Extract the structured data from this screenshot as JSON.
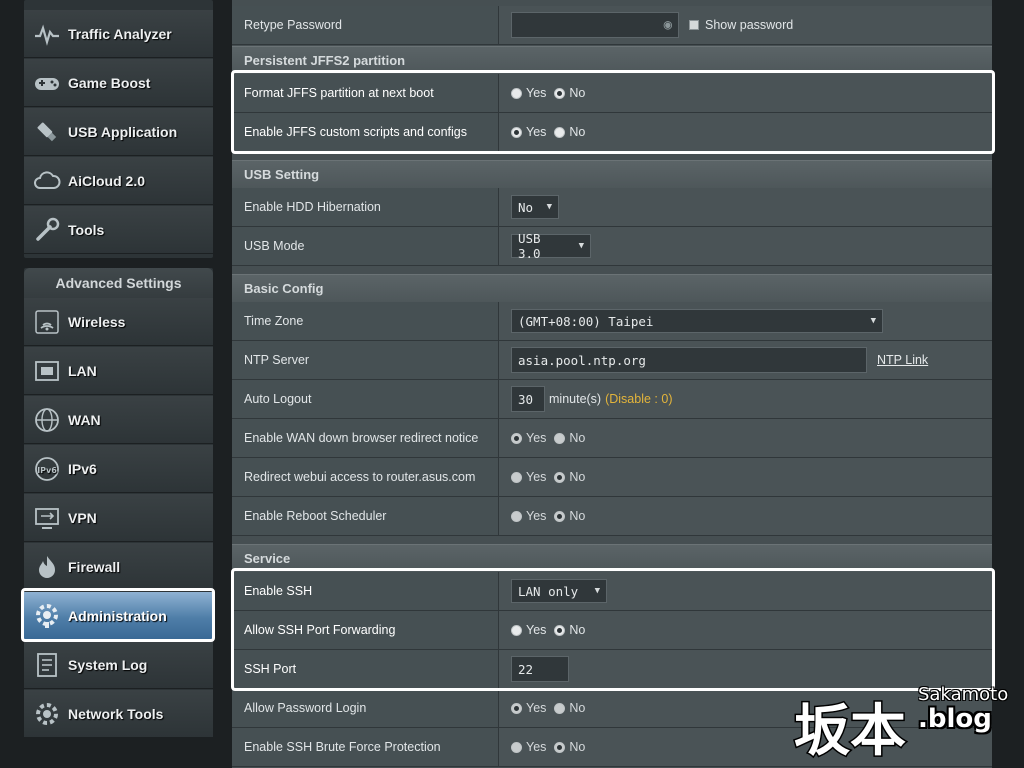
{
  "sidebar": {
    "top_items": [
      {
        "label": "Traffic Analyzer",
        "icon": "traffic-analyzer-icon"
      },
      {
        "label": "Game Boost",
        "icon": "gamepad-icon"
      },
      {
        "label": "USB Application",
        "icon": "usb-icon"
      },
      {
        "label": "AiCloud 2.0",
        "icon": "cloud-icon"
      },
      {
        "label": "Tools",
        "icon": "wrench-icon"
      }
    ],
    "advanced_heading": "Advanced Settings",
    "advanced_items": [
      {
        "label": "Wireless",
        "icon": "wireless-icon"
      },
      {
        "label": "LAN",
        "icon": "lan-icon"
      },
      {
        "label": "WAN",
        "icon": "globe-icon"
      },
      {
        "label": "IPv6",
        "icon": "ipv6-icon"
      },
      {
        "label": "VPN",
        "icon": "vpn-icon"
      },
      {
        "label": "Firewall",
        "icon": "firewall-icon"
      },
      {
        "label": "Administration",
        "icon": "admin-gear-icon",
        "active": true
      },
      {
        "label": "System Log",
        "icon": "system-log-icon"
      },
      {
        "label": "Network Tools",
        "icon": "network-tools-icon"
      }
    ]
  },
  "retype_password": {
    "label": "Retype Password",
    "value": "",
    "show_password_label": "Show password"
  },
  "jffs": {
    "header": "Persistent JFFS2 partition",
    "rows": [
      {
        "label": "Format JFFS partition at next boot",
        "yes": "Yes",
        "no": "No",
        "selected": "No"
      },
      {
        "label": "Enable JFFS custom scripts and configs",
        "yes": "Yes",
        "no": "No",
        "selected": "Yes"
      }
    ]
  },
  "usb": {
    "header": "USB Setting",
    "hdd_hibernation": {
      "label": "Enable HDD Hibernation",
      "value": "No"
    },
    "usb_mode": {
      "label": "USB Mode",
      "value": "USB 3.0"
    }
  },
  "basic": {
    "header": "Basic Config",
    "time_zone": {
      "label": "Time Zone",
      "value": "(GMT+08:00) Taipei"
    },
    "ntp_server": {
      "label": "NTP Server",
      "value": "asia.pool.ntp.org",
      "link": "NTP Link"
    },
    "auto_logout": {
      "label": "Auto Logout",
      "value": "30",
      "unit": "minute(s)",
      "note": "(Disable : 0)"
    },
    "wan_redirect": {
      "label": "Enable WAN down browser redirect notice",
      "yes": "Yes",
      "no": "No",
      "selected": "Yes"
    },
    "redirect_webui": {
      "label": "Redirect webui access to router.asus.com",
      "yes": "Yes",
      "no": "No",
      "selected": "No"
    },
    "reboot_scheduler": {
      "label": "Enable Reboot Scheduler",
      "yes": "Yes",
      "no": "No",
      "selected": "No"
    }
  },
  "service": {
    "header": "Service",
    "enable_ssh": {
      "label": "Enable SSH",
      "value": "LAN only"
    },
    "ssh_port_forwarding": {
      "label": "Allow SSH Port Forwarding",
      "yes": "Yes",
      "no": "No",
      "selected": "No"
    },
    "ssh_port": {
      "label": "SSH Port",
      "value": "22"
    },
    "password_login": {
      "label": "Allow Password Login",
      "yes": "Yes",
      "no": "No",
      "selected": "Yes"
    },
    "brute_force": {
      "label": "Enable SSH Brute Force Protection",
      "yes": "Yes",
      "no": "No",
      "selected": "No"
    }
  },
  "watermark": {
    "text": "Sakamoto",
    "blog": ".blog",
    "kanji": "坂本"
  }
}
